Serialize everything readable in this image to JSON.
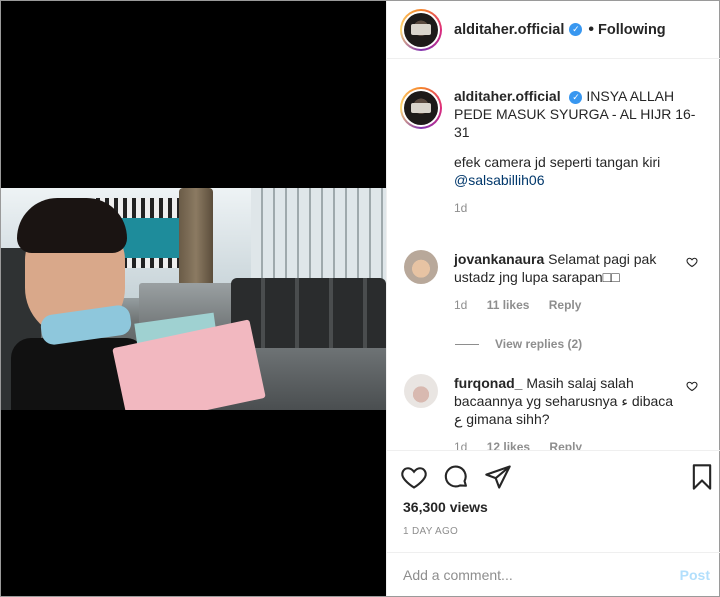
{
  "header": {
    "username": "alditaher.official",
    "separator": "•",
    "follow_status": "Following"
  },
  "caption": {
    "username": "alditaher.official",
    "text": "INSYA ALLAH PEDE MASUK SYURGA - AL HIJR 16-31",
    "body": "efek camera jd seperti tangan kiri",
    "mention": "@salsabillih06",
    "time": "1d"
  },
  "comments": [
    {
      "username": "jovankanaura",
      "text": "Selamat pagi pak ustadz jng lupa sarapan□□",
      "time": "1d",
      "likes": "11 likes",
      "reply": "Reply",
      "view_replies": "View replies (2)"
    },
    {
      "username": "furqonad_",
      "text": "Masih salaj salah bacaannya yg seharusnya ء dibaca ع gimana sihh?",
      "time": "1d",
      "likes": "12 likes",
      "reply": "Reply"
    }
  ],
  "stats": {
    "views": "36,300 views",
    "posted": "1 DAY AGO"
  },
  "comment_box": {
    "placeholder": "Add a comment...",
    "post_label": "Post"
  },
  "colors": {
    "verified": "#3897f0",
    "link": "#00376b",
    "post_disabled": "#b2dffc"
  }
}
